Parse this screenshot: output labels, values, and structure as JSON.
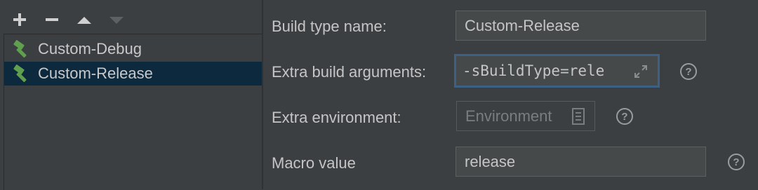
{
  "toolbar": {
    "add_icon": "plus-icon",
    "remove_icon": "minus-icon",
    "move_up_icon": "triangle-up-icon",
    "move_down_icon": "triangle-down-icon"
  },
  "build_types": [
    {
      "label": "Custom-Debug",
      "icon": "hammer-icon",
      "selected": false
    },
    {
      "label": "Custom-Release",
      "icon": "hammer-icon",
      "selected": true
    }
  ],
  "form": {
    "build_type_name": {
      "label": "Build type name:",
      "value": "Custom-Release"
    },
    "extra_build_arguments": {
      "label": "Extra build arguments:",
      "value": "-sBuildType=rele"
    },
    "extra_environment": {
      "label": "Extra environment:",
      "placeholder": "Environment"
    },
    "macro_value": {
      "label": "Macro value",
      "value": "release"
    },
    "help_glyph": "?"
  },
  "colors": {
    "background": "#3c3f41",
    "selection": "#0d293e",
    "focus_border": "#3d6185",
    "hammer_green": "#5fa04e"
  }
}
